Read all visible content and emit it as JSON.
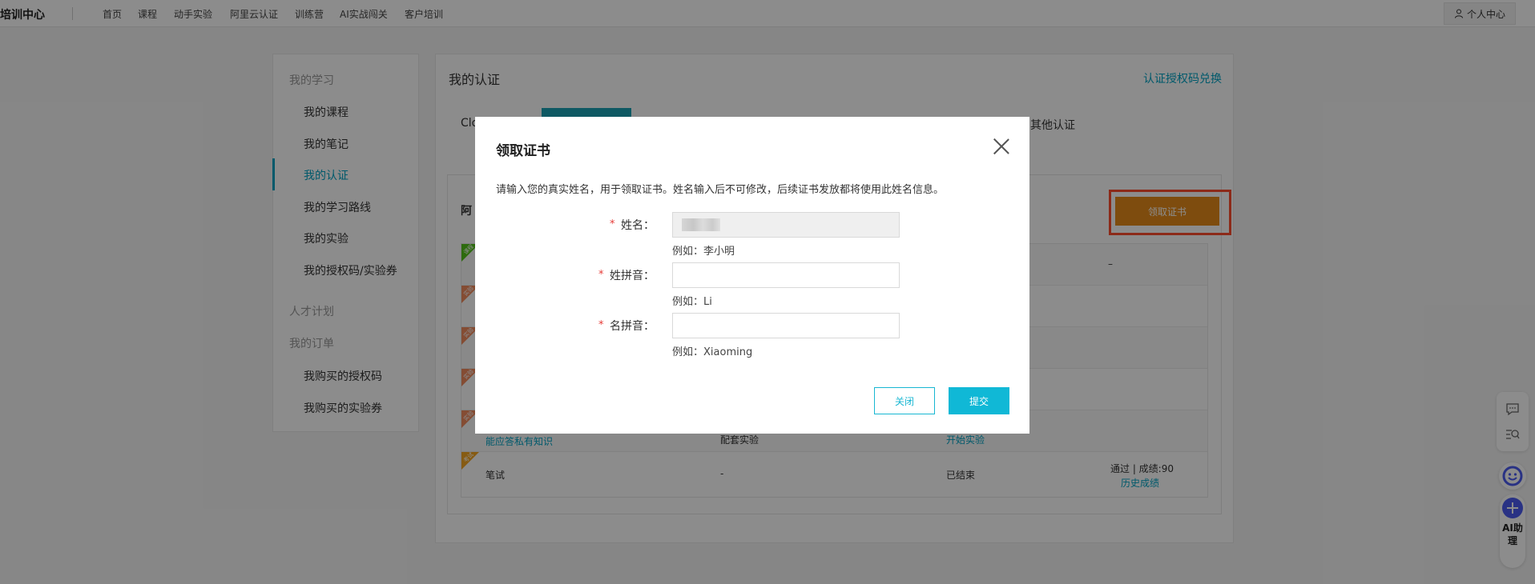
{
  "topnav": {
    "brand": "培训中心",
    "links": [
      "首页",
      "课程",
      "动手实验",
      "阿里云认证",
      "训练营",
      "AI实战闯关",
      "客户培训"
    ],
    "user_center": "个人中心"
  },
  "sidebar": {
    "group_learning": "我的学习",
    "items": [
      "我的课程",
      "我的笔记",
      "我的认证",
      "我的学习路线",
      "我的实验",
      "我的授权码/实验券"
    ],
    "active_item": "我的认证",
    "group_talent": "人才计划",
    "group_orders": "我的订单",
    "order_items": [
      "我购买的授权码",
      "我购买的实验券"
    ]
  },
  "main": {
    "title": "我的认证",
    "redeem_link": "认证授权码兑换",
    "tab_partial": "Clo",
    "tab_other": "其他认证",
    "card_head_partial": "阿",
    "claim_button": "领取证书",
    "rows": [
      {
        "col4": "–"
      },
      {},
      {},
      {},
      {
        "col1": "能应答私有知识",
        "col2": "配套实验",
        "col3": "开始实验"
      },
      {
        "badge": "考试",
        "col1": "笔试",
        "col2": "-",
        "col3": "已结束",
        "col4": "通过 | 成绩:90",
        "col4_link": "历史成绩"
      }
    ],
    "badges": [
      "课程",
      "实验",
      "实验",
      "实验",
      "实验",
      "考试"
    ]
  },
  "modal": {
    "title": "领取证书",
    "description": "请输入您的真实姓名，用于领取证书。姓名输入后不可修改，后续证书发放都将使用此姓名信息。",
    "fields": [
      {
        "label": "姓名：",
        "value": "",
        "hint": "例如：李小明"
      },
      {
        "label": "姓拼音：",
        "value": "",
        "hint": "例如：Li"
      },
      {
        "label": "名拼音：",
        "value": "",
        "hint": "例如：Xiaoming"
      }
    ],
    "required_mark": "*",
    "close_button": "关闭",
    "submit_button": "提交"
  },
  "float": {
    "ai_label": "AI助理"
  },
  "colors": {
    "accent": "#00a3c4",
    "claim_orange": "#e58a1a",
    "highlight_red": "#ff4d2e",
    "submit_cyan": "#10b8d6"
  }
}
